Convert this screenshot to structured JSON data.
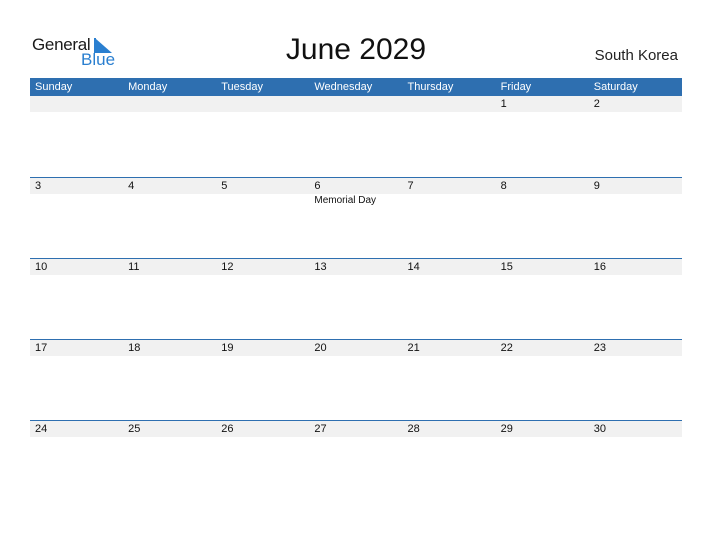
{
  "logo": {
    "word1": "General",
    "word2": "Blue"
  },
  "title": "June 2029",
  "country": "South Korea",
  "colors": {
    "accent": "#2e6fb0",
    "band": "#f1f1f1"
  },
  "weekdays": [
    "Sunday",
    "Monday",
    "Tuesday",
    "Wednesday",
    "Thursday",
    "Friday",
    "Saturday"
  ],
  "weeks": [
    {
      "days": [
        "",
        "",
        "",
        "",
        "",
        "1",
        "2"
      ],
      "events": [
        "",
        "",
        "",
        "",
        "",
        "",
        ""
      ]
    },
    {
      "days": [
        "3",
        "4",
        "5",
        "6",
        "7",
        "8",
        "9"
      ],
      "events": [
        "",
        "",
        "",
        "Memorial Day",
        "",
        "",
        ""
      ]
    },
    {
      "days": [
        "10",
        "11",
        "12",
        "13",
        "14",
        "15",
        "16"
      ],
      "events": [
        "",
        "",
        "",
        "",
        "",
        "",
        ""
      ]
    },
    {
      "days": [
        "17",
        "18",
        "19",
        "20",
        "21",
        "22",
        "23"
      ],
      "events": [
        "",
        "",
        "",
        "",
        "",
        "",
        ""
      ]
    },
    {
      "days": [
        "24",
        "25",
        "26",
        "27",
        "28",
        "29",
        "30"
      ],
      "events": [
        "",
        "",
        "",
        "",
        "",
        "",
        ""
      ]
    }
  ]
}
